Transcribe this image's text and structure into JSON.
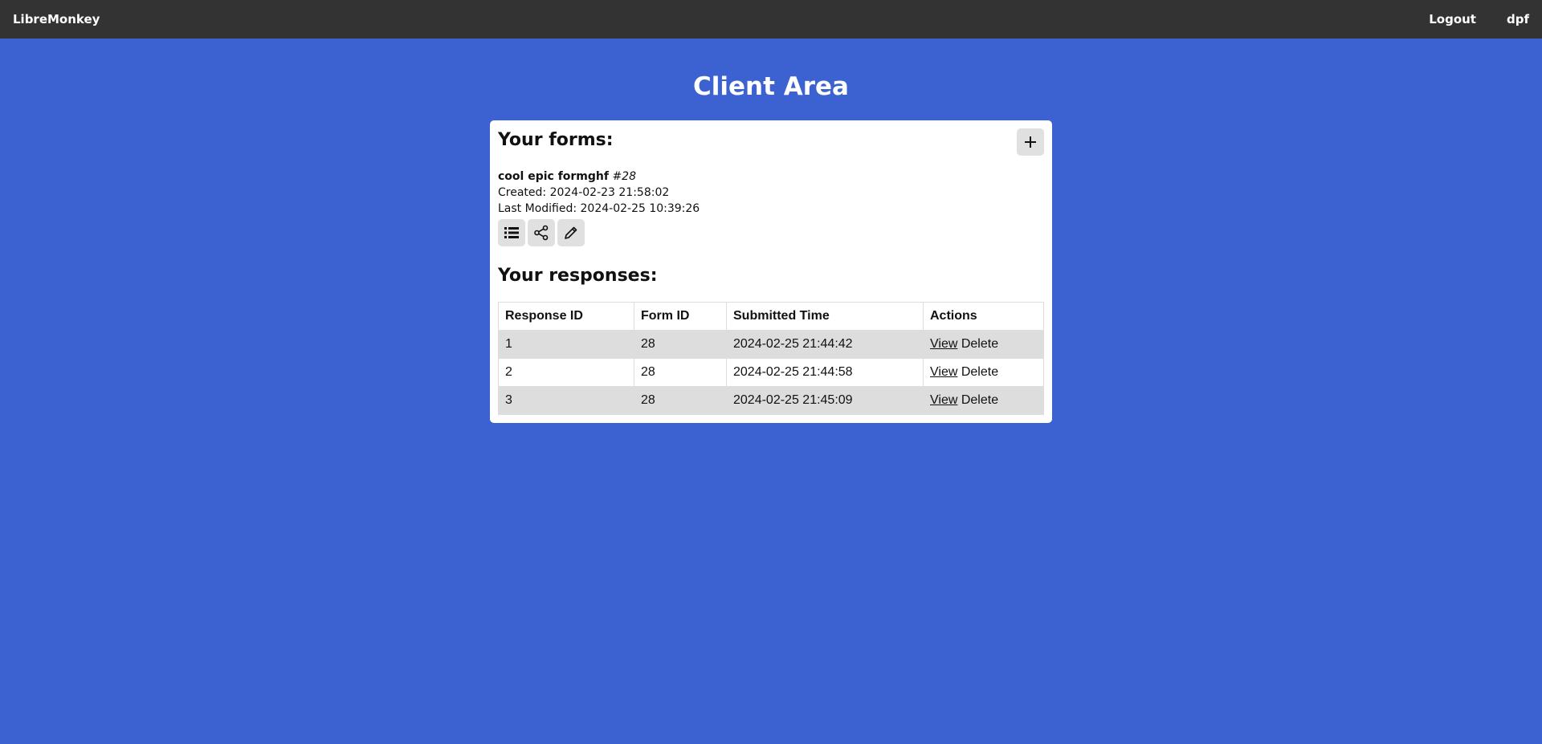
{
  "app": {
    "brand": "LibreMonkey",
    "logout_label": "Logout",
    "username": "dpf"
  },
  "page": {
    "title": "Client Area"
  },
  "forms_section": {
    "title": "Your forms:",
    "add_icon": "plus-icon",
    "forms": [
      {
        "name": "cool epic formghf",
        "number": "#28",
        "created": "Created: 2024-02-23 21:58:02",
        "modified": "Last Modified: 2024-02-25 10:39:26",
        "action_icons": [
          "list-icon",
          "share-icon",
          "pencil-icon"
        ]
      }
    ]
  },
  "responses_section": {
    "title": "Your responses:",
    "columns": [
      "Response ID",
      "Form ID",
      "Submitted Time",
      "Actions"
    ],
    "rows": [
      {
        "id": "1",
        "form_id": "28",
        "time": "2024-02-25 21:44:42",
        "view": "View",
        "delete": "Delete"
      },
      {
        "id": "2",
        "form_id": "28",
        "time": "2024-02-25 21:44:58",
        "view": "View",
        "delete": "Delete"
      },
      {
        "id": "3",
        "form_id": "28",
        "time": "2024-02-25 21:45:09",
        "view": "View",
        "delete": "Delete"
      }
    ]
  }
}
